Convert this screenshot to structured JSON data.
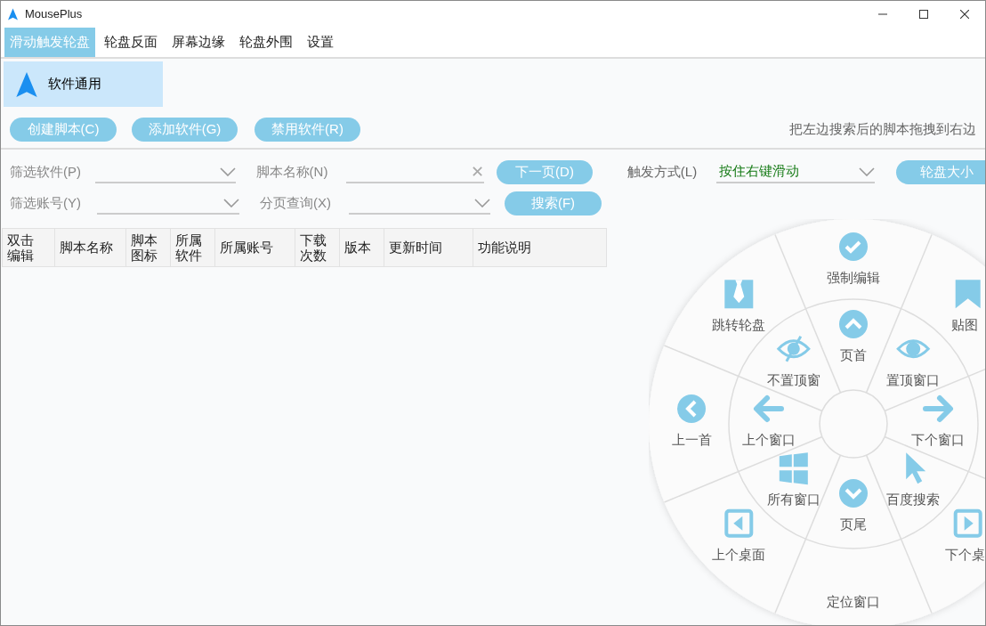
{
  "window": {
    "title": "MousePlus"
  },
  "tabs": [
    {
      "label": "滑动触发轮盘",
      "selected": true
    },
    {
      "label": "轮盘反面",
      "selected": false
    },
    {
      "label": "屏幕边缘",
      "selected": false
    },
    {
      "label": "轮盘外围",
      "selected": false
    },
    {
      "label": "设置",
      "selected": false
    }
  ],
  "software_list": [
    {
      "label": "软件通用",
      "selected": true
    }
  ],
  "action_buttons": [
    "创建脚本(C)",
    "添加软件(G)",
    "禁用软件(R)"
  ],
  "hint": "把左边搜索后的脚本拖拽到右边",
  "filters": {
    "software": {
      "label": "筛选软件(P)"
    },
    "account": {
      "label": "筛选账号(Y)"
    },
    "script_name": {
      "label": "脚本名称(N)",
      "clear": "✕"
    },
    "page": {
      "label": "分页查询(X)"
    }
  },
  "next_button": "下一页(D)",
  "search_button": "搜索(F)",
  "trigger": {
    "label": "触发方式(L)",
    "value": "按住右键滑动"
  },
  "wheel_size_button": "轮盘大小",
  "table": {
    "columns": [
      "双击编辑",
      "脚本名称",
      "脚本图标",
      "所属软件",
      "所属账号",
      "下载次数",
      "版本",
      "更新时间",
      "功能说明"
    ]
  },
  "wheel": {
    "outer": [
      {
        "label": "强制编辑"
      },
      {
        "label": "跳转轮盘"
      },
      {
        "label": "贴图"
      },
      {
        "label": "上一首"
      },
      {
        "label": "上个桌面"
      },
      {
        "label": "下个桌"
      },
      {
        "label": "定位窗口"
      }
    ],
    "inner": [
      {
        "label": "页首"
      },
      {
        "label": "不置顶窗"
      },
      {
        "label": "置顶窗口"
      },
      {
        "label": "上个窗口"
      },
      {
        "label": "下个窗口"
      },
      {
        "label": "所有窗口"
      },
      {
        "label": "百度搜索"
      },
      {
        "label": "页尾"
      }
    ]
  }
}
